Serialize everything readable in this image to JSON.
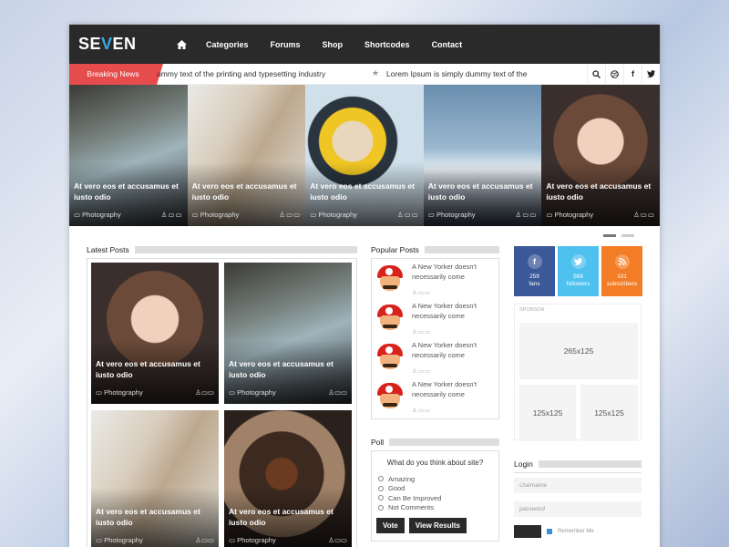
{
  "header": {
    "logo": "SEVEN",
    "logo_prefix": "SE",
    "logo_accent": "V",
    "logo_suffix": "EN",
    "nav": [
      "Categories",
      "Forums",
      "Shop",
      "Shortcodes",
      "Contact"
    ]
  },
  "breaking": {
    "label": "Breaking News",
    "items": [
      "ummy text of the printing and typesetting industry",
      "Lorem Ipsum is simply dummy text of the"
    ]
  },
  "slides": [
    {
      "caption": "At vero eos et accusamus et iusto odio",
      "category": "Photography"
    },
    {
      "caption": "At vero eos et accusamus et iusto odio",
      "category": "Photography"
    },
    {
      "caption": "At vero eos et accusamus et iusto odio",
      "category": "Photography"
    },
    {
      "caption": "At vero eos et accusamus et iusto odio",
      "category": "Photography"
    },
    {
      "caption": "At vero eos et accusamus et iusto odio",
      "category": "Photography"
    }
  ],
  "latest": {
    "title": "Latest Posts",
    "posts": [
      {
        "caption": "At vero eos et accusamus et iusto odio",
        "category": "Photography"
      },
      {
        "caption": "At vero eos et accusamus et iusto odio",
        "category": "Photography"
      },
      {
        "caption": "At vero eos et accusamus et iusto odio",
        "category": "Photography"
      },
      {
        "caption": "At vero eos et accusamus et iusto odio",
        "category": "Photography"
      }
    ]
  },
  "popular": {
    "title": "Popular Posts",
    "posts": [
      "A New Yorker doesn't necessarily come",
      "A New Yorker doesn't necessarily come",
      "A New Yorker doesn't necessarily come",
      "A New Yorker doesn't necessarily come"
    ]
  },
  "poll": {
    "title": "Poll",
    "question": "What do you think about site?",
    "options": [
      "Amazing",
      "Good",
      "Can Be Improved",
      "Not Comments"
    ],
    "vote": "Vote",
    "results": "View Results"
  },
  "social": [
    {
      "count": "259",
      "label": "fans",
      "icon": "f"
    },
    {
      "count": "568",
      "label": "followers",
      "icon": "t"
    },
    {
      "count": "101",
      "label": "subscribers",
      "icon": "rss"
    }
  ],
  "sponsor": {
    "label": "SPONSOR",
    "big": "265x125",
    "small1": "125x125",
    "small2": "125x125"
  },
  "login": {
    "title": "Login",
    "username_placeholder": "Username",
    "password_placeholder": "password",
    "remember": "Remember Me"
  },
  "colors": {
    "header_bg": "#2a2a2a",
    "accent_red": "#e74c4c",
    "facebook": "#3b5998",
    "twitter": "#4fc1ef",
    "rss": "#f37c26"
  }
}
